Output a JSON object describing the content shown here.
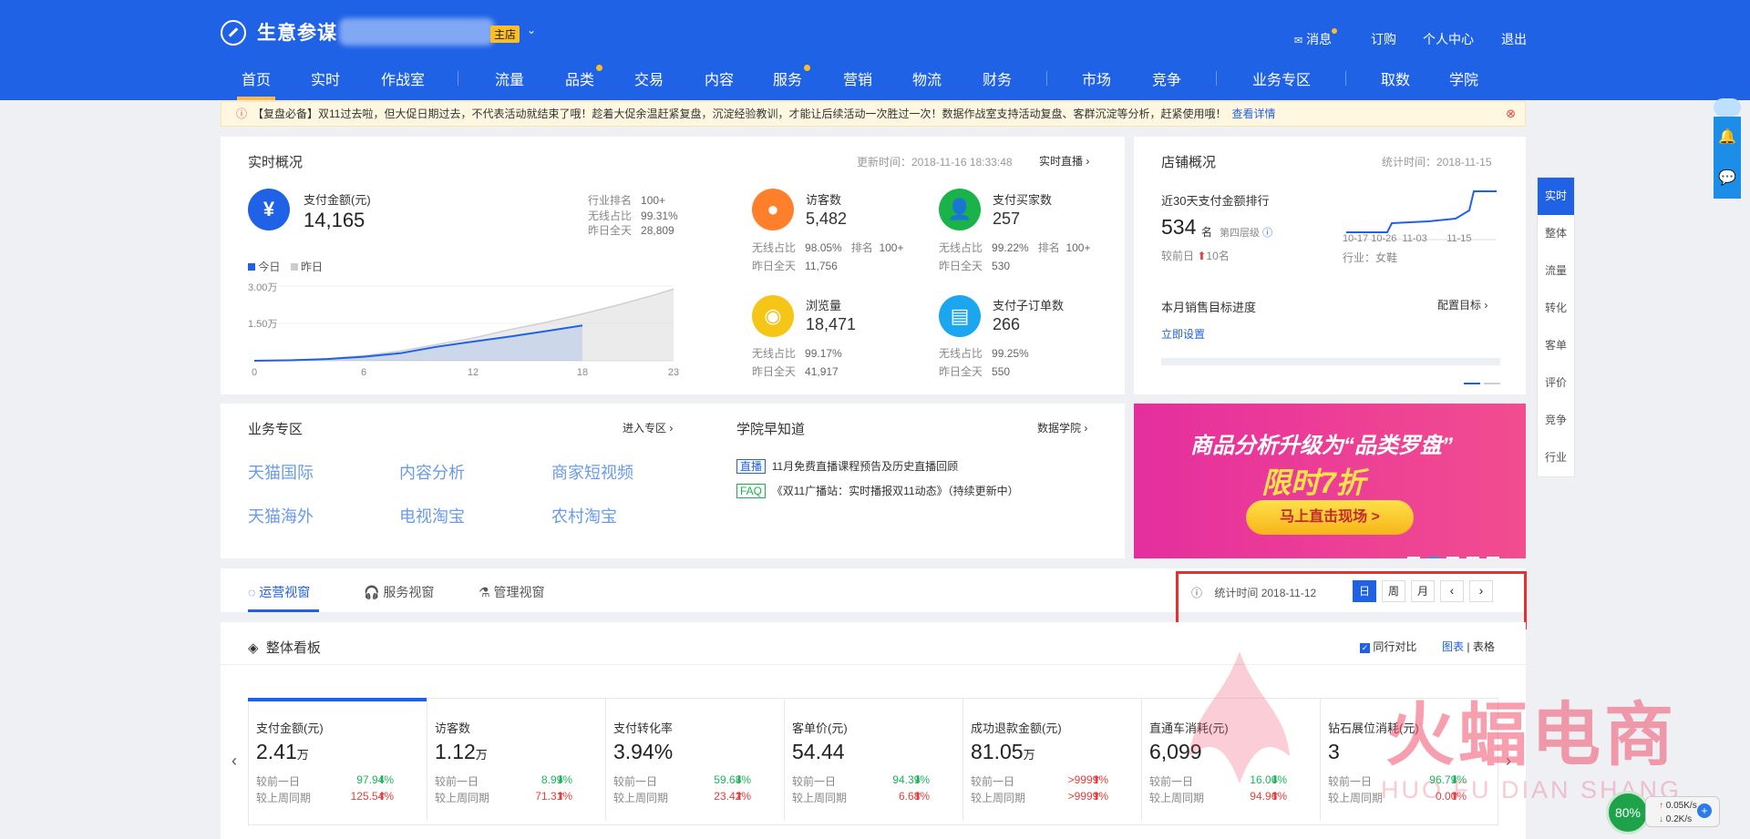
{
  "header": {
    "brand": "生意参谋",
    "shop_badge": "主店",
    "links": [
      "消息",
      "订购",
      "个人中心",
      "退出"
    ],
    "nav": [
      "首页",
      "实时",
      "作战室",
      "流量",
      "品类",
      "交易",
      "内容",
      "服务",
      "营销",
      "物流",
      "财务",
      "市场",
      "竞争",
      "业务专区",
      "取数",
      "学院"
    ]
  },
  "notice": {
    "text": "【复盘必备】双11过去啦，但大促日期过去，不代表活动就结束了哦！趁着大促余温赶紧复盘，沉淀经验教训，才能让后续活动一次胜过一次！数据作战室支持活动复盘、客群沉淀等分析，赶紧使用哦！",
    "link": "查看详情"
  },
  "realtime": {
    "title": "实时概况",
    "update_time": "更新时间：2018-11-16 18:33:48",
    "live_link": "实时直播",
    "pay_label": "支付金额(元)",
    "pay_value": "14,165",
    "industry_rank_label": "行业排名",
    "industry_rank": "100+",
    "wireless_label": "无线占比",
    "wireless": "99.31%",
    "yesterday_label": "昨日全天",
    "yesterday": "28,809",
    "legend_today": "今日",
    "legend_yesterday": "昨日",
    "y_ticks": [
      "3.00万",
      "1.50万"
    ],
    "x_ticks": [
      "0",
      "6",
      "12",
      "18",
      "23"
    ],
    "metrics": [
      {
        "label": "访客数",
        "value": "5,482",
        "wireless": "98.05%",
        "rank_label": "排名",
        "rank": "100+",
        "yesterday": "11,756"
      },
      {
        "label": "支付买家数",
        "value": "257",
        "wireless": "99.22%",
        "rank_label": "排名",
        "rank": "100+",
        "yesterday": "530"
      },
      {
        "label": "浏览量",
        "value": "18,471",
        "wireless": "99.17%",
        "yesterday": "41,917"
      },
      {
        "label": "支付子订单数",
        "value": "266",
        "wireless": "99.25%",
        "yesterday": "550"
      }
    ],
    "wireless_short": "无线占比",
    "yesterday_short": "昨日全天"
  },
  "chart_data": {
    "type": "area",
    "x": [
      0,
      2,
      4,
      6,
      8,
      10,
      12,
      14,
      16,
      18,
      20,
      22,
      23
    ],
    "ylim": [
      0,
      30000
    ],
    "series": [
      {
        "name": "今日",
        "values": [
          0,
          200,
          700,
          1600,
          3000,
          5600,
          7700,
          9700,
          11900,
          14165
        ]
      },
      {
        "name": "昨日",
        "values": [
          0,
          300,
          800,
          2000,
          3900,
          6500,
          9100,
          12500,
          15400,
          18800,
          22500,
          26500,
          28809
        ]
      }
    ],
    "x_ticks": [
      "0",
      "6",
      "12",
      "18",
      "23"
    ],
    "y_ticks": [
      "1.50万",
      "3.00万"
    ]
  },
  "store": {
    "title": "店铺概况",
    "stat_time": "统计时间：2018-11-15",
    "rank_title": "近30天支付金额排行",
    "rank_value": "534",
    "rank_unit": "名",
    "tier": "第四层级",
    "compare_label": "较前日",
    "compare_value": "10名",
    "x_ticks": [
      "10-17",
      "10-26",
      "11-03",
      "11-15"
    ],
    "industry": "行业：女鞋",
    "goal_title": "本月销售目标进度",
    "goal_link": "配置目标",
    "set_now": "立即设置"
  },
  "biz": {
    "title": "业务专区",
    "enter": "进入专区",
    "items": [
      "天猫国际",
      "内容分析",
      "商家短视频",
      "天猫海外",
      "电视淘宝",
      "农村淘宝"
    ]
  },
  "academy": {
    "title": "学院早知道",
    "link": "数据学院",
    "items": [
      {
        "tag": "直播",
        "text": "11月免费直播课程预告及历史直播回顾"
      },
      {
        "tag": "FAQ",
        "text": "《双11广播站：实时播报双11动态》（持续更新中）"
      }
    ]
  },
  "banner": {
    "line1": "商品分析升级为“品类罗盘”",
    "line2": "限时7折",
    "button": "马上直击现场 >"
  },
  "right_sidebar": [
    "实时",
    "整体",
    "流量",
    "转化",
    "客单",
    "评价",
    "竞争",
    "行业"
  ],
  "views": {
    "tabs": [
      "运营视窗",
      "服务视窗",
      "管理视窗"
    ],
    "stat_label": "统计时间 2018-11-12",
    "periods": [
      "日",
      "周",
      "月"
    ]
  },
  "board": {
    "title": "整体看板",
    "compare_label": "同行对比",
    "chart_link": "图表",
    "table_link": "表格",
    "row1_label": "较前一日",
    "row2_label": "较上周同期",
    "kpis": [
      {
        "label": "支付金额(元)",
        "value": "2.41",
        "unit": "万",
        "d1": "97.94%",
        "d1dir": "down",
        "d2": "125.54%",
        "d2dir": "up"
      },
      {
        "label": "访客数",
        "value": "1.12",
        "unit": "万",
        "d1": "8.99%",
        "d1dir": "down",
        "d2": "71.31%",
        "d2dir": "up"
      },
      {
        "label": "支付转化率",
        "value": "3.94%",
        "unit": "",
        "d1": "59.68%",
        "d1dir": "down",
        "d2": "23.42%",
        "d2dir": "up"
      },
      {
        "label": "客单价(元)",
        "value": "54.44",
        "unit": "",
        "d1": "94.39%",
        "d1dir": "down",
        "d2": "6.68%",
        "d2dir": "up"
      },
      {
        "label": "成功退款金额(元)",
        "value": "81.05",
        "unit": "万",
        "d1": ">9999%",
        "d1dir": "up",
        "d2": ">9999%",
        "d2dir": "up"
      },
      {
        "label": "直通车消耗(元)",
        "value": "6,099",
        "unit": "",
        "d1": "16.06%",
        "d1dir": "down",
        "d2": "94.96%",
        "d2dir": "up"
      },
      {
        "label": "钻石展位消耗(元)",
        "value": "3",
        "unit": "",
        "d1": "96.79%",
        "d1dir": "down",
        "d2": "0.00%",
        "d2dir": "up"
      }
    ]
  },
  "watermark": {
    "cn": "火蝠电商",
    "en": "HUO FU DIAN SHANG"
  },
  "net_widget": {
    "percent": "80%",
    "up": "0.05K/s",
    "down": "0.2K/s"
  }
}
